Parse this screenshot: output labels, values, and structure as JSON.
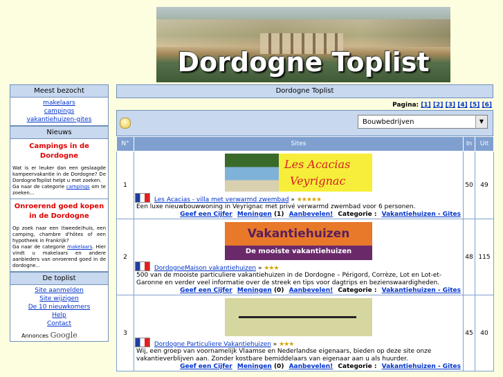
{
  "banner": {
    "title": "Dordogne Toplist"
  },
  "sidebar": {
    "most_visited": {
      "heading": "Meest bezocht",
      "links": [
        "makelaars",
        "campings",
        "vakantiehuizen-gites"
      ]
    },
    "news": {
      "heading": "Nieuws",
      "items": [
        {
          "title": "Campings in de Dordogne",
          "text": "Wat is er leuker dan een geslaagde kampeervakantie in de Dordogne? De DordogneToplist helpt u met zoeken.",
          "link_prefix": "Ga naar de categorie ",
          "link": "campings",
          "link_suffix": " om te zoeken..."
        },
        {
          "title": "Onroerend goed kopen in de Dordogne",
          "text": "Op zoek naar een (tweede)huis, een camping, chambre d'hôtes of een hypotheek in Frankrijk?",
          "link_prefix": "Ga naar de categorie ",
          "link": "makelaars",
          "link_suffix": ". Hier vindt u makelaars en andere aanbieders van onroerend goed in de dordogne..."
        }
      ]
    },
    "toplist": {
      "heading": "De toplist",
      "links": [
        "Site aanmelden",
        "Site wijzigen",
        "De 10 nieuwkomers",
        "Help",
        "Contact"
      ]
    },
    "google": {
      "label": "Annonces",
      "brand": "Google"
    }
  },
  "main": {
    "heading": "Dordogne Toplist",
    "pager": {
      "label": "Pagina:",
      "pages": [
        "[1]",
        "[2]",
        "[3]",
        "[4]",
        "[5]",
        "[6]"
      ]
    },
    "filter": {
      "selected": "Bouwbedrijven",
      "arrow": "▼"
    },
    "columns": {
      "num": "N°",
      "sites": "Sites",
      "in": "In",
      "out": "Uit"
    },
    "rows": [
      {
        "num": "1",
        "title": "Les Acacias - villa met verwarmd zwembad",
        "stars": "★★★★★",
        "rating_sep": " » ",
        "banner_line1": "Les Acacias",
        "banner_line2": "Veyrignac",
        "desc": "Een luxe nieuwbouwwoning in Veyrignac met privé verwarmd zwembad voor 6 personen.",
        "rate": "Geef een Cijfer",
        "opinions": "Meningen",
        "opinions_count": "(1)",
        "recommend": "Aanbevelen!",
        "cat_label": "Categorie :",
        "category": "Vakantiehuizen - Gites",
        "in": "50",
        "out": "49"
      },
      {
        "num": "2",
        "title": "DordogneMaison vakantiehuizen",
        "stars": "★★★",
        "rating_sep": " » ",
        "banner_line1": "Vakantiehuizen",
        "banner_line2": "De mooiste vakantiehuizen",
        "desc": "500 van de mooiste particuliere vakantiehuizen in de Dordogne – Périgord, Corrèze, Lot en Lot-et-Garonne en verder veel informatie over de streek en tips voor dagtrips en bezienswaardigheden.",
        "rate": "Geef een Cijfer",
        "opinions": "Meningen",
        "opinions_count": "(0)",
        "recommend": "Aanbevelen!",
        "cat_label": "Categorie :",
        "category": "Vakantiehuizen - Gites",
        "in": "48",
        "out": "115"
      },
      {
        "num": "3",
        "title": "Dordogne Particuliere Vakantiehuizen",
        "stars": "★★★",
        "rating_sep": " » ",
        "desc": "Wij, een groep van voornamelijk Vlaamse en Nederlandse eigenaars, bieden op deze site onze vakantieverblijven aan. Zonder kostbare bemiddelaars van eigenaar aan u als huurder.",
        "rate": "Geef een Cijfer",
        "opinions": "Meningen",
        "opinions_count": "(0)",
        "recommend": "Aanbevelen!",
        "cat_label": "Categorie :",
        "category": "Vakantiehuizen - Gites",
        "in": "45",
        "out": "40"
      }
    ]
  },
  "colors": {
    "header_blue": "#c7d8ef",
    "column_blue": "#7f9fcf",
    "news_red": "#e00000",
    "link": "#0033cc",
    "page_bg": "#fdfde0"
  }
}
